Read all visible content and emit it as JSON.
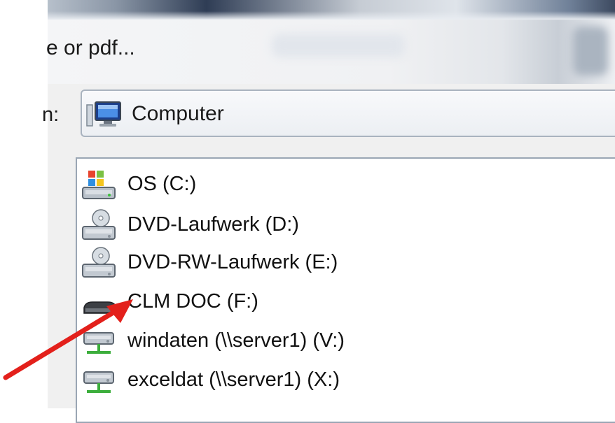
{
  "dialog": {
    "caption": "e or pdf...",
    "lookin_label": "n:",
    "lookin_value": "Computer"
  },
  "drives": [
    {
      "label": "OS (C:)",
      "icon": "windows-drive-icon"
    },
    {
      "label": "DVD-Laufwerk (D:)",
      "icon": "dvd-drive-icon"
    },
    {
      "label": "DVD-RW-Laufwerk (E:)",
      "icon": "dvd-drive-icon"
    },
    {
      "label": "CLM DOC (F:)",
      "icon": "removable-drive-icon"
    },
    {
      "label": "windaten (\\\\server1) (V:)",
      "icon": "network-drive-icon"
    },
    {
      "label": "exceldat (\\\\server1) (X:)",
      "icon": "network-drive-icon"
    }
  ],
  "colors": {
    "arrow": "#e3201b",
    "list_border": "#9aa6b4",
    "dialog_bg": "#f0f0f0"
  }
}
